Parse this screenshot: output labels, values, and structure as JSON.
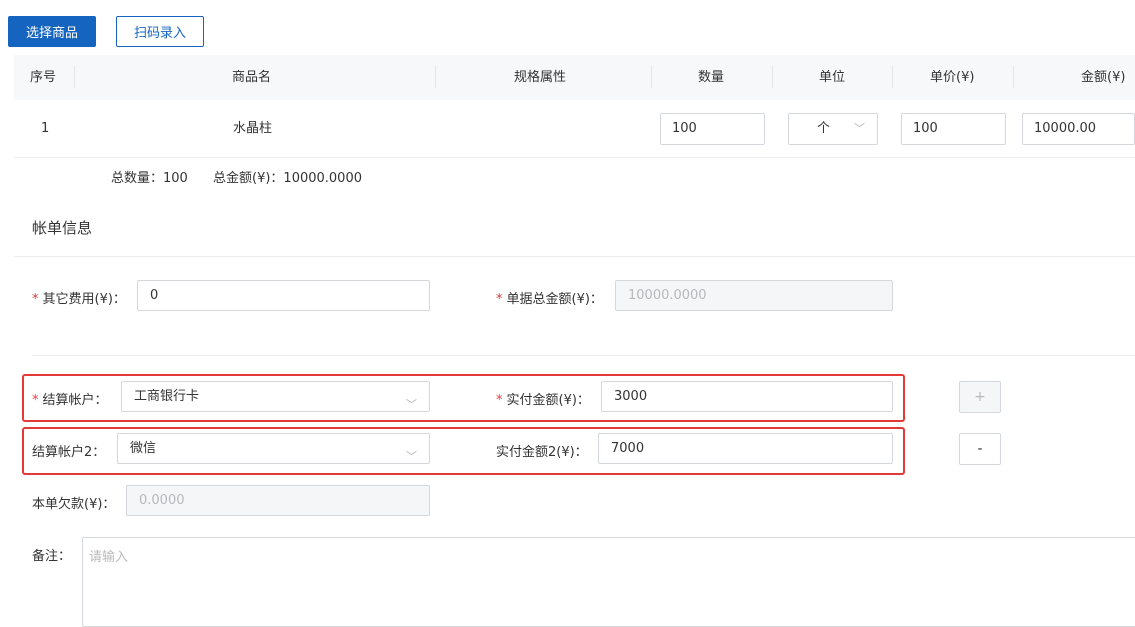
{
  "toolbar": {
    "select_goods_label": "选择商品",
    "scan_entry_label": "扫码录入"
  },
  "table": {
    "headers": {
      "index": "序号",
      "name": "商品名",
      "spec": "规格属性",
      "qty": "数量",
      "unit": "单位",
      "price": "单价(¥)",
      "amount": "金额(¥)"
    },
    "rows": [
      {
        "index": "1",
        "name": "水晶柱",
        "spec": "",
        "qty": "100",
        "unit": "个",
        "price": "100",
        "amount": "10000.00"
      }
    ]
  },
  "summary": {
    "total_qty_label": "总数量：",
    "total_qty": "100",
    "total_amount_label": "总金额(¥)：",
    "total_amount": "10000.0000"
  },
  "bill": {
    "title": "帐单信息",
    "other_fee_label": "其它费用(¥)：",
    "other_fee": "0",
    "doc_total_label": "单据总金额(¥)：",
    "doc_total": "10000.0000",
    "account1_label": "结算帐户：",
    "account1": "工商银行卡",
    "paid1_label": "实付金额(¥)：",
    "paid1": "3000",
    "account2_label": "结算帐户2：",
    "account2": "微信",
    "paid2_label": "实付金额2(¥)：",
    "paid2": "7000",
    "add_label": "+",
    "remove_label": "-",
    "debt_label": "本单欠款(¥)：",
    "debt": "0.0000",
    "remark_label": "备注：",
    "remark_placeholder": "请输入"
  },
  "colors": {
    "primary": "#1565c0",
    "required": "#e53935",
    "highlight_box": "#e53935"
  },
  "icons": {
    "select_arrow": "chevron-down-icon"
  }
}
